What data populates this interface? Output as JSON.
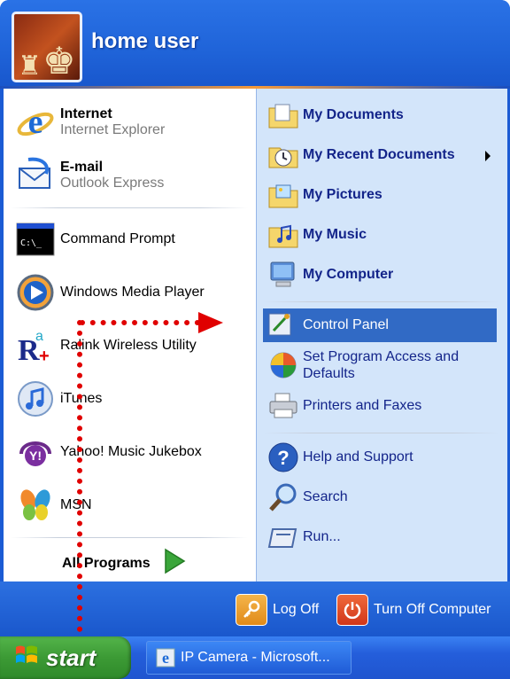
{
  "user": {
    "name": "home user"
  },
  "left_items": [
    {
      "name": "Internet",
      "sub": "Internet Explorer"
    },
    {
      "name": "E-mail",
      "sub": "Outlook Express"
    },
    {
      "name": "Command Prompt"
    },
    {
      "name": "Windows Media Player"
    },
    {
      "name": "Ralink Wireless Utility"
    },
    {
      "name": "iTunes"
    },
    {
      "name": "Yahoo! Music Jukebox"
    },
    {
      "name": "MSN"
    }
  ],
  "all_programs": "All Programs",
  "right_items": [
    {
      "name": "My Documents"
    },
    {
      "name": "My Recent Documents"
    },
    {
      "name": "My Pictures"
    },
    {
      "name": "My Music"
    },
    {
      "name": "My Computer"
    },
    {
      "name": "Control Panel"
    },
    {
      "name": "Set Program Access and Defaults"
    },
    {
      "name": "Printers and Faxes"
    },
    {
      "name": "Help and Support"
    },
    {
      "name": "Search"
    },
    {
      "name": "Run..."
    }
  ],
  "footer": {
    "logoff": "Log Off",
    "turnoff": "Turn Off Computer"
  },
  "taskbar": {
    "start": "start",
    "task": "IP Camera - Microsoft..."
  },
  "colors": {
    "highlight": "#316ac5",
    "arrow": "#e00000"
  }
}
